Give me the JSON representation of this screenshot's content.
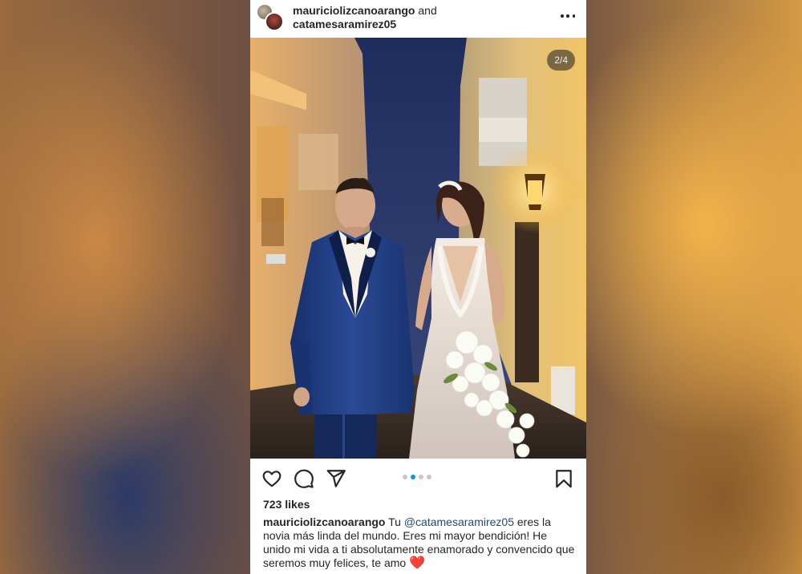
{
  "post": {
    "header": {
      "user1": "mauriciolizcanoarango",
      "joiner": " and",
      "user2": "catamesaramirez05"
    },
    "carousel": {
      "counter": "2/4",
      "total": 4,
      "active_index": 2
    },
    "icons": {
      "like": "heart-icon",
      "comment": "comment-icon",
      "share": "send-icon",
      "save": "bookmark-icon",
      "more": "more-icon"
    },
    "likes": "723 likes",
    "caption": {
      "user": "mauriciolizcanoarango",
      "pre": " Tu ",
      "mention": "@catamesaramirez05",
      "body": "  eres la novia más linda del mundo. Eres mi mayor bendición! He unido mi vida a ti absolutamente enamorado y  convencido que seremos muy felices, te amo ",
      "emoji": "❤️"
    },
    "colors": {
      "accent": "#0095f6",
      "text": "#262626",
      "heart": "#d7192b"
    }
  }
}
